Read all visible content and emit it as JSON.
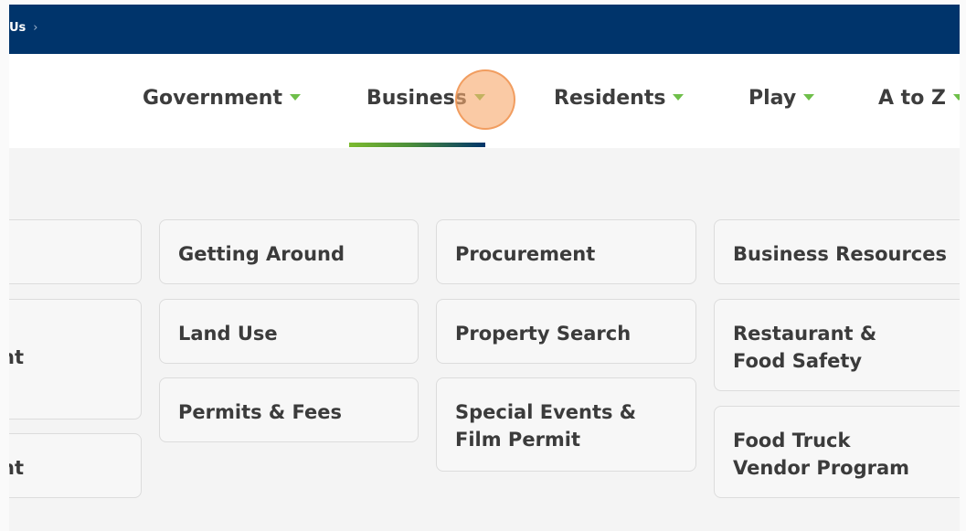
{
  "breadcrumb": {
    "text": "Us",
    "separator": "›"
  },
  "nav": {
    "items": [
      {
        "label": "Government"
      },
      {
        "label": "Business"
      },
      {
        "label": "Residents"
      },
      {
        "label": "Play"
      },
      {
        "label": "A to Z"
      }
    ],
    "active": "Business"
  },
  "menu": {
    "col0": [
      "",
      "nt",
      "nt"
    ],
    "col1": [
      "Getting Around",
      "Land Use",
      "Permits & Fees"
    ],
    "col2": [
      "Procurement",
      "Property Search",
      "Special Events & Film Permit"
    ],
    "col3": [
      "Business Resources",
      "Restaurant & Food Safety",
      "Food Truck Vendor Program"
    ]
  },
  "colors": {
    "header_bg": "#00346b",
    "accent_green": "#6fbf4a",
    "click_marker": "#f7aa6e"
  }
}
